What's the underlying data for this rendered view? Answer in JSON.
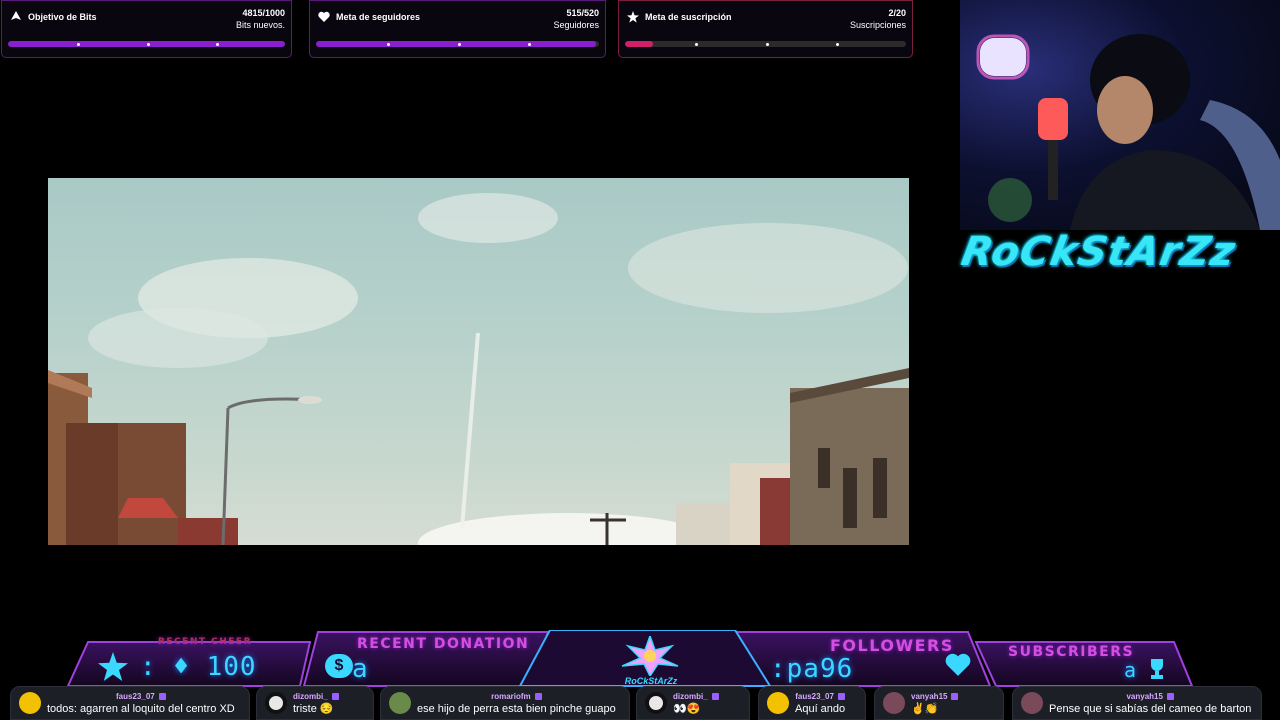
{
  "goals": {
    "bits": {
      "title": "Objetivo de Bits",
      "count": "4815/1000",
      "sub": "Bits nuevos.",
      "progress": 1.0,
      "icon": "bits-icon"
    },
    "followers": {
      "title": "Meta de seguidores",
      "count": "515/520",
      "sub": "Seguidores",
      "progress": 0.99,
      "icon": "heart-handshake-icon"
    },
    "subscriptions": {
      "title": "Meta de suscripción",
      "count": "2/20",
      "sub": "Suscripciones",
      "progress": 0.1,
      "icon": "star-icon"
    }
  },
  "webcam": {
    "channel_name": "RoCkStArZz"
  },
  "bottom_bar": {
    "recent_cheer": {
      "label": "RECENT CHEER",
      "value": ": ♦ 100"
    },
    "recent_donation": {
      "label": "RECENT DONATION",
      "value": "a"
    },
    "center_logo": "RoCkStArZz",
    "followers": {
      "label": "FOLLOWERS",
      "value": ":pa96"
    },
    "subscribers": {
      "label": "SUBSCRIBERS",
      "value": "a"
    }
  },
  "chat": [
    {
      "user": "faus23_07",
      "text": "todos: agarren al loquito del centro XD"
    },
    {
      "user": "dizombi_",
      "text": "triste 😔"
    },
    {
      "user": "romariofm",
      "text": "ese hijo de perra esta bien pinche guapo"
    },
    {
      "user": "dizombi_",
      "text": "👀😍"
    },
    {
      "user": "faus23_07",
      "text": "Aquí ando"
    },
    {
      "user": "vanyah15",
      "text": "✌️👏"
    },
    {
      "user": "vanyah15",
      "text": "Pense que si sabías del cameo de barton"
    }
  ],
  "colors": {
    "accent_purple": "#8a1fd0",
    "accent_pink": "#d0206a",
    "neon_cyan": "#3ad8ff"
  }
}
